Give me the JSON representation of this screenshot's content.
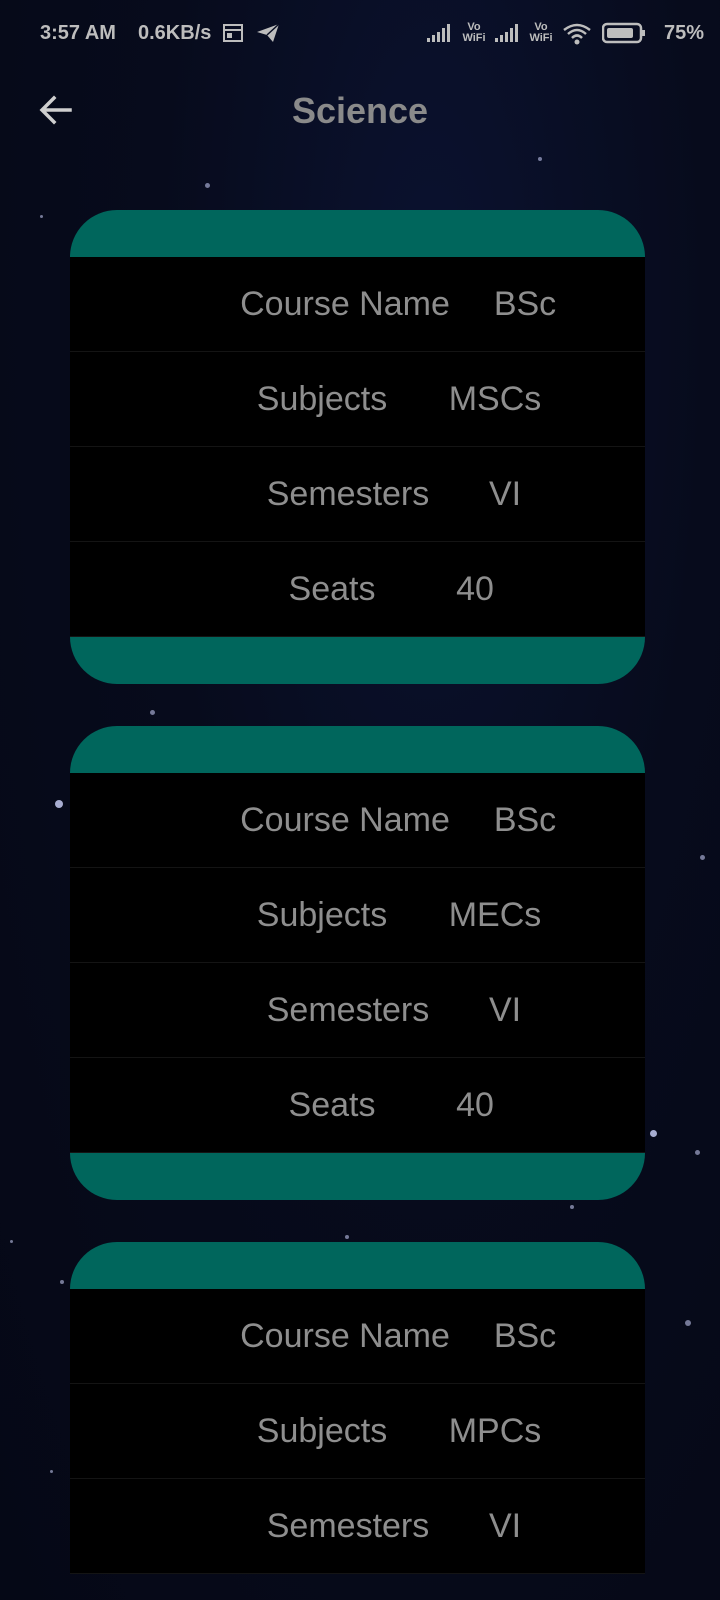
{
  "status_bar": {
    "time": "3:57 AM",
    "speed": "0.6KB/s",
    "volte1": "Vo WiFi",
    "volte2": "Vo WiFi",
    "battery": "75%",
    "icons": [
      "calendar-icon",
      "telegram-icon",
      "signal-icon",
      "wifi-icon",
      "battery-icon"
    ]
  },
  "appbar": {
    "title": "Science",
    "back_icon": "arrow-back-icon"
  },
  "cards": [
    {
      "rows": [
        {
          "label": "Course Name",
          "value": "BSc"
        },
        {
          "label": "Subjects",
          "value": "MSCs"
        },
        {
          "label": "Semesters",
          "value": "VI"
        },
        {
          "label": "Seats",
          "value": "40"
        }
      ]
    },
    {
      "rows": [
        {
          "label": "Course Name",
          "value": "BSc"
        },
        {
          "label": "Subjects",
          "value": "MECs"
        },
        {
          "label": "Semesters",
          "value": "VI"
        },
        {
          "label": "Seats",
          "value": "40"
        }
      ]
    },
    {
      "rows": [
        {
          "label": "Course Name",
          "value": "BSc"
        },
        {
          "label": "Subjects",
          "value": "MPCs"
        },
        {
          "label": "Semesters",
          "value": "VI"
        }
      ]
    }
  ],
  "colors": {
    "accent": "#00665c",
    "card_bg": "#000000",
    "text": "#8e8e8e"
  }
}
